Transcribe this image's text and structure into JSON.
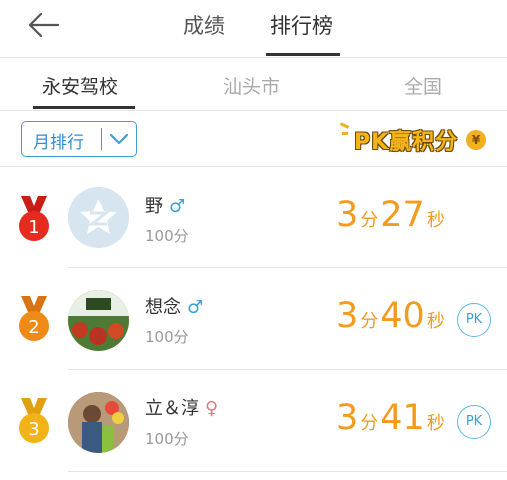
{
  "header": {
    "tabs": [
      {
        "label": "成绩"
      },
      {
        "label": "排行榜"
      }
    ]
  },
  "scope_tabs": [
    {
      "label": "永安驾校"
    },
    {
      "label": "汕头市"
    },
    {
      "label": "全国"
    }
  ],
  "filter": {
    "label": "月排行"
  },
  "pk_banner": {
    "text": "PK赢积分",
    "coin": "¥"
  },
  "rankings": [
    {
      "rank": "1",
      "name": "野",
      "gender": "♂",
      "score": "100分",
      "time_min": "3",
      "min_unit": "分",
      "time_sec": "27",
      "sec_unit": "秒",
      "pk": ""
    },
    {
      "rank": "2",
      "name": "想念",
      "gender": "♂",
      "score": "100分",
      "time_min": "3",
      "min_unit": "分",
      "time_sec": "40",
      "sec_unit": "秒",
      "pk": "PK"
    },
    {
      "rank": "3",
      "name": "立＆淳",
      "gender": "♀",
      "score": "100分",
      "time_min": "3",
      "min_unit": "分",
      "time_sec": "41",
      "sec_unit": "秒",
      "pk": "PK"
    }
  ],
  "colors": {
    "accent_blue": "#3aa0d8",
    "time_orange": "#f39b1e",
    "medal_gold": "#f2b316",
    "medal_silver_orange": "#ef8a16",
    "medal_red": "#e42b1e"
  }
}
